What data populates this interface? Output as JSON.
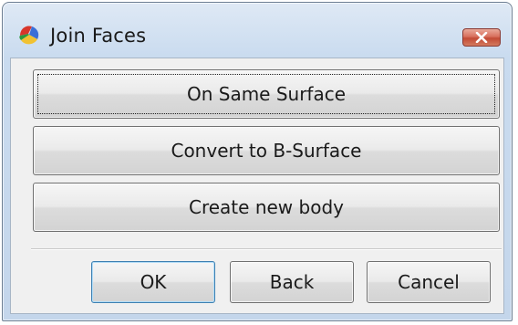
{
  "window": {
    "title": "Join Faces",
    "close_icon": "close-icon"
  },
  "options": {
    "on_same_surface": "On Same Surface",
    "convert_to_bsurface": "Convert to B-Surface",
    "create_new_body": "Create new body"
  },
  "footer": {
    "ok": "OK",
    "back": "Back",
    "cancel": "Cancel"
  },
  "colors": {
    "close_button": "#c24b35",
    "default_button_border": "#3c7fb1"
  }
}
